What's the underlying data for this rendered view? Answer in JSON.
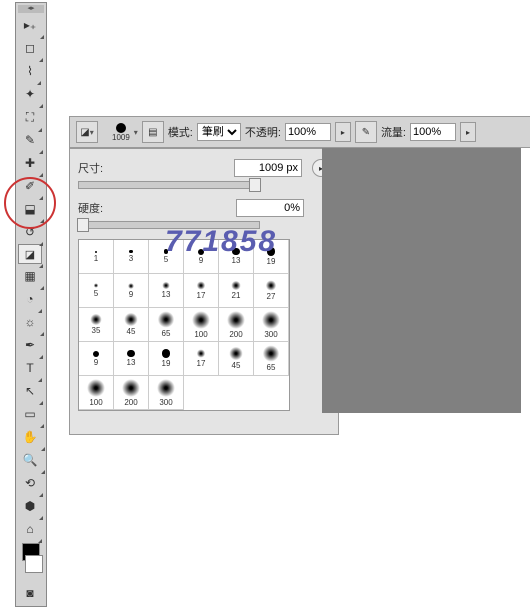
{
  "watermark": "771858",
  "options": {
    "brush_size": "1009",
    "mode_label": "模式:",
    "mode_value": "筆刷",
    "opacity_label": "不透明:",
    "opacity_value": "100%",
    "flow_label": "流量:",
    "flow_value": "100%"
  },
  "panel": {
    "size_label": "尺寸:",
    "size_value": "1009 px",
    "hardness_label": "硬度:",
    "hardness_value": "0%"
  },
  "presets": [
    {
      "s": 1,
      "h": false
    },
    {
      "s": 3,
      "h": false
    },
    {
      "s": 5,
      "h": false
    },
    {
      "s": 9,
      "h": false
    },
    {
      "s": 13,
      "h": false
    },
    {
      "s": 19,
      "h": false
    },
    {
      "s": 5,
      "h": true
    },
    {
      "s": 9,
      "h": true
    },
    {
      "s": 13,
      "h": true
    },
    {
      "s": 17,
      "h": true
    },
    {
      "s": 21,
      "h": true
    },
    {
      "s": 27,
      "h": true
    },
    {
      "s": 35,
      "h": true
    },
    {
      "s": 45,
      "h": true
    },
    {
      "s": 65,
      "h": true
    },
    {
      "s": 100,
      "h": true
    },
    {
      "s": 200,
      "h": true
    },
    {
      "s": 300,
      "h": true
    },
    {
      "s": 9,
      "h": false
    },
    {
      "s": 13,
      "h": false
    },
    {
      "s": 19,
      "h": false
    },
    {
      "s": 17,
      "h": true
    },
    {
      "s": 45,
      "h": true
    },
    {
      "s": 65,
      "h": true
    },
    {
      "s": 100,
      "h": true
    },
    {
      "s": 200,
      "h": true
    },
    {
      "s": 300,
      "h": true
    }
  ],
  "tools": [
    "move",
    "marquee",
    "lasso",
    "wand",
    "crop",
    "eyedropper",
    "heal",
    "brush",
    "stamp",
    "history",
    "eraser",
    "gradient",
    "blur",
    "dodge",
    "pen",
    "type",
    "path",
    "rect",
    "hand",
    "zoom",
    "rotate",
    "3d",
    "camera",
    "edit",
    "mask"
  ]
}
